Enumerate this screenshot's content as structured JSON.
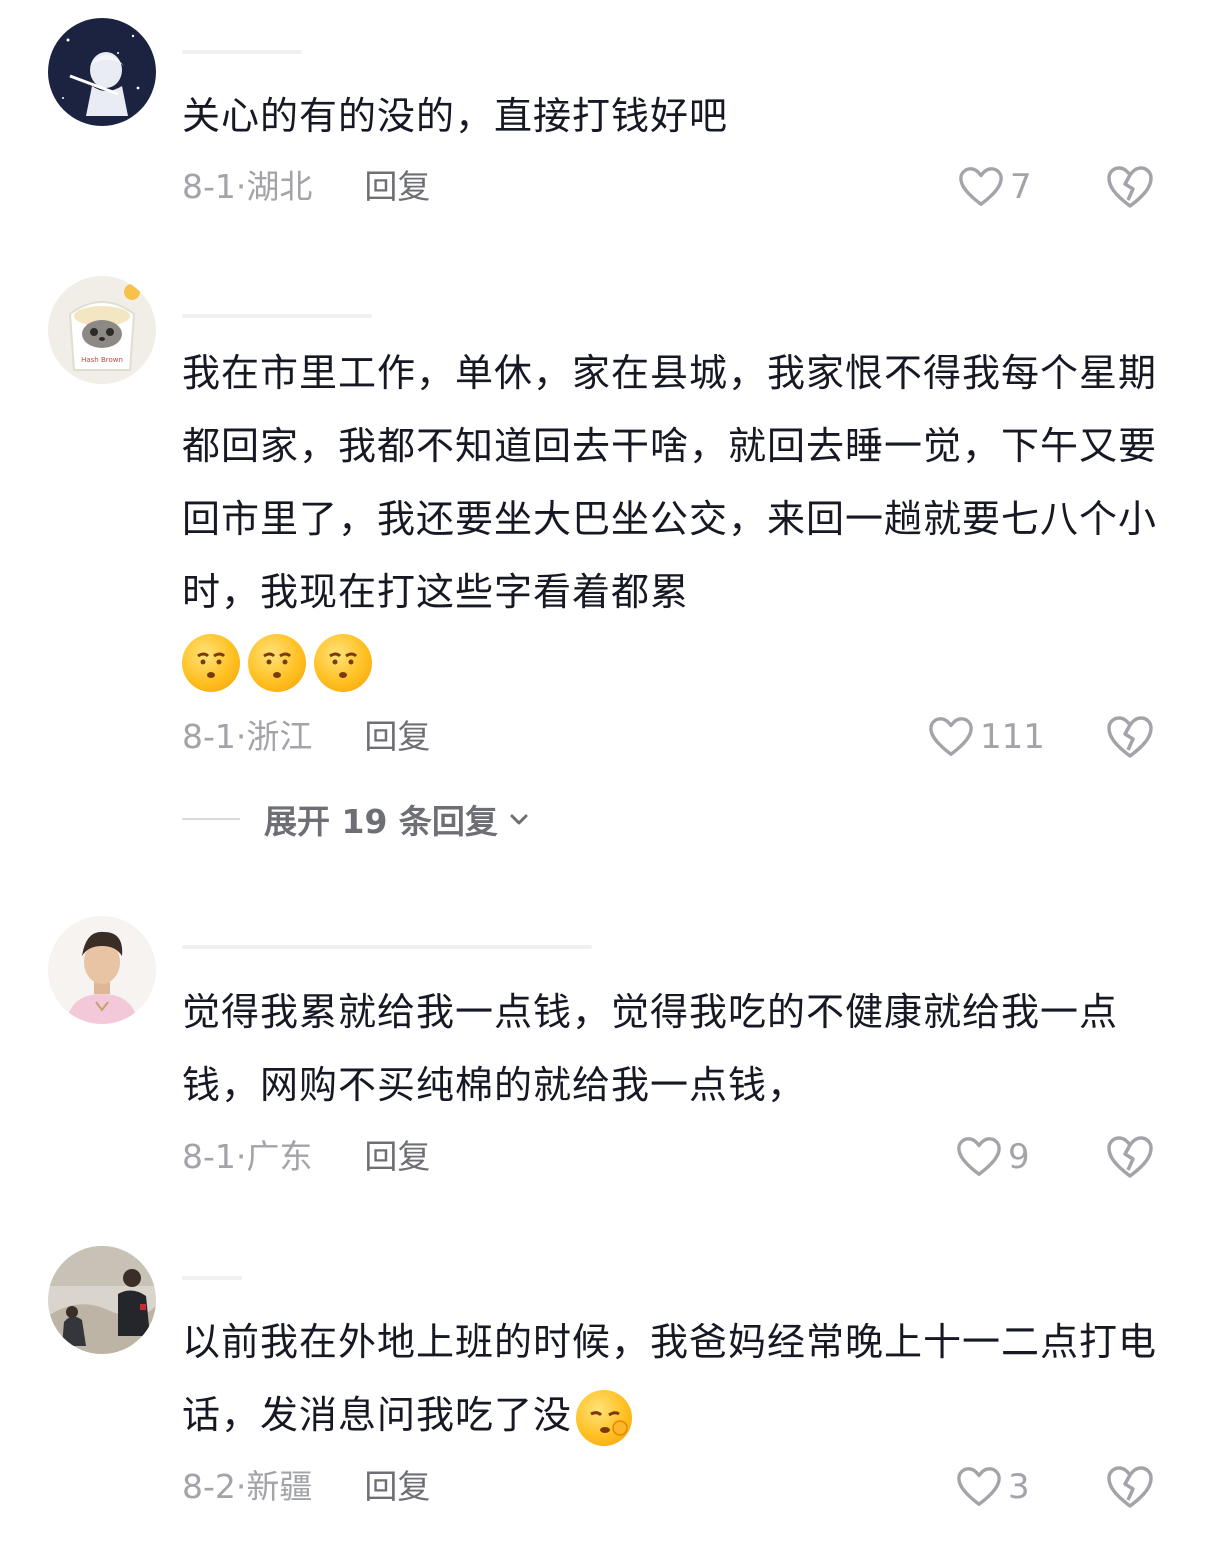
{
  "comments": [
    {
      "text": "关心的有的没的，直接打钱好吧",
      "date": "8-1",
      "sep": "·",
      "region": "湖北",
      "reply_label": "回复",
      "likes": "7",
      "avatar_icon": "starry-boy-avatar-icon"
    },
    {
      "text": "我在市里工作，单休，家在县城，我家恨不得我每个星期都回家，我都不知道回去干啥，就回去睡一觉，下午又要回市里了，我还要坐大巴坐公交，来回一趟就要七八个小时，我现在打这些字看着都累",
      "emojis": [
        "tired-face-emoji",
        "tired-face-emoji",
        "tired-face-emoji"
      ],
      "date": "8-1",
      "sep": "·",
      "region": "浙江",
      "reply_label": "回复",
      "likes": "111",
      "expand_label": "展开 19 条回复",
      "avatar_icon": "hash-brown-avatar-icon",
      "avatar_text": "Hash Brown"
    },
    {
      "text": "觉得我累就给我一点钱，觉得我吃的不健康就给我一点钱，网购不买纯棉的就给我一点钱，",
      "date": "8-1",
      "sep": "·",
      "region": "广东",
      "reply_label": "回复",
      "likes": "9",
      "avatar_icon": "man-portrait-avatar-icon"
    },
    {
      "text": "以前我在外地上班的时候，我爸妈经常晚上十一二点打电话，发消息问我吃了没",
      "emojis": [
        "thinking-face-emoji"
      ],
      "date": "8-2",
      "sep": "·",
      "region": "新疆",
      "reply_label": "回复",
      "likes": "3",
      "avatar_icon": "outdoor-photo-avatar-icon"
    }
  ],
  "colors": {
    "text": "#161823",
    "meta": "#a3a4a9",
    "reply": "#6e6f75",
    "emoji": "#ffc021"
  }
}
